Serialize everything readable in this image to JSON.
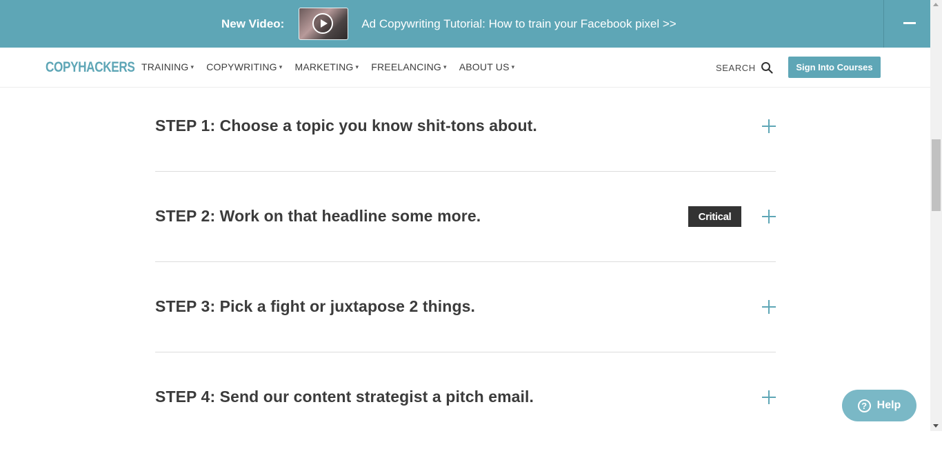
{
  "promo": {
    "new_label": "New Video:",
    "link_text": "Ad Copywriting Tutorial: How to train your Facebook pixel >>",
    "thumbnail_icon": "play-icon",
    "collapse_icon": "minus-icon"
  },
  "nav": {
    "logo": "COPYHACKERS",
    "menu": [
      {
        "label": "TRAINING"
      },
      {
        "label": "COPYWRITING"
      },
      {
        "label": "MARKETING"
      },
      {
        "label": "FREELANCING"
      },
      {
        "label": "ABOUT US"
      }
    ],
    "search_label": "SEARCH",
    "signin_label": "Sign Into Courses"
  },
  "steps": [
    {
      "title": "STEP 1: Choose a topic you know shit-tons about."
    },
    {
      "title": "STEP 2: Work on that headline some more.",
      "badge": "Critical"
    },
    {
      "title": "STEP 3: Pick a fight or juxtapose 2 things."
    },
    {
      "title": "STEP 4: Send our content strategist a pitch email."
    }
  ],
  "help": {
    "label": "Help",
    "icon": "question-icon"
  },
  "colors": {
    "accent": "#5ea6b6",
    "badge_bg": "#333333",
    "help_bg": "#7ab8c6"
  }
}
